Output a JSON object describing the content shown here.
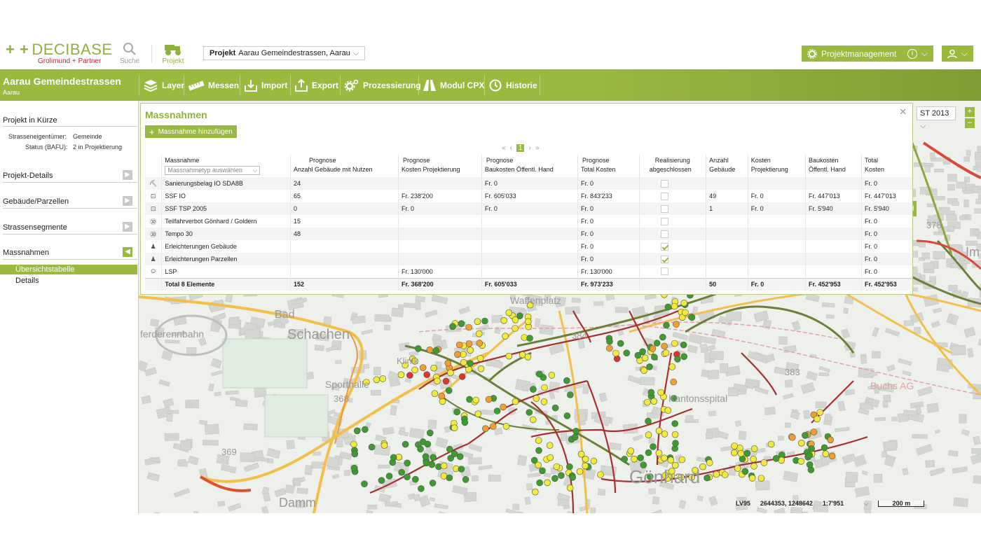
{
  "brand": {
    "name": "DECIBASE",
    "company": "Grolimund + Partner"
  },
  "topbar": {
    "search_label": "Suche",
    "project_label": "Projekt",
    "project_select_label": "Projekt",
    "project_select_value": "Aarau Gemeindestrassen, Aarau",
    "projektmanagement_label": "Projektmanagement"
  },
  "header": {
    "title": "Aarau Gemeindestrassen",
    "subtitle": "Aarau",
    "tools": [
      {
        "label": "Layer",
        "icon": "layers-icon"
      },
      {
        "label": "Messen",
        "icon": "ruler-icon"
      },
      {
        "label": "Import",
        "icon": "import-icon"
      },
      {
        "label": "Export",
        "icon": "export-icon"
      },
      {
        "label": "Prozessierung",
        "icon": "gear-icon"
      },
      {
        "label": "Modul CPX",
        "icon": "road-icon"
      },
      {
        "label": "Historie",
        "icon": "history-icon"
      }
    ]
  },
  "sidebar": {
    "summary_title": "Projekt in Kürze",
    "owner_label": "Strasseneigentümer:",
    "owner_value": "Gemeinde",
    "status_label": "Status (BAFU):",
    "status_value": "2 in Projektierung",
    "sections": [
      "Projekt-Details",
      "Gebäude/Parzellen",
      "Strassensegmente",
      "Massnahmen"
    ],
    "subitems": [
      "Übersichtstabelle",
      "Details"
    ]
  },
  "panel": {
    "title": "Massnahmen",
    "add_label": "Massnahme hinzufügen",
    "pager": {
      "first": "«",
      "prev": "‹",
      "current": "1",
      "next": "›",
      "last": "»"
    },
    "type_placeholder": "Massnahmetyp auswählen",
    "columns": [
      {
        "line1": "Massnahme",
        "line2": ""
      },
      {
        "line1": "Prognose",
        "line2": "Anzahl Gebäude mit Nutzen"
      },
      {
        "line1": "Prognose",
        "line2": "Kosten Projektierung"
      },
      {
        "line1": "Prognose",
        "line2": "Baukosten Öffentl. Hand"
      },
      {
        "line1": "Prognose",
        "line2": "Total Kosten"
      },
      {
        "line1": "Realisierung",
        "line2": "abgeschlossen"
      },
      {
        "line1": "Anzahl",
        "line2": "Gebäude"
      },
      {
        "line1": "Kosten",
        "line2": "Projektierung"
      },
      {
        "line1": "Baukosten",
        "line2": "Öffentl. Hand"
      },
      {
        "line1": "Total",
        "line2": "Kosten"
      }
    ],
    "rows": [
      {
        "icon": "paver-icon",
        "name": "Sanierungsbelag IO SDA8B",
        "anzahl": "24",
        "kproj": "",
        "bau": "Fr. 0",
        "total": "Fr. 0",
        "done": false,
        "geb": "",
        "kproj2": "",
        "bau2": "",
        "total2": "Fr. 0"
      },
      {
        "icon": "window-icon",
        "name": "SSF IO",
        "anzahl": "65",
        "kproj": "Fr. 238'200",
        "bau": "Fr. 605'033",
        "total": "Fr. 843'233",
        "done": false,
        "geb": "49",
        "kproj2": "Fr. 0",
        "bau2": "Fr. 447'013",
        "total2": "Fr. 447'013"
      },
      {
        "icon": "window-icon",
        "name": "SSF TSP 2005",
        "anzahl": "0",
        "kproj": "Fr. 0",
        "bau": "Fr. 0",
        "total": "Fr. 0",
        "done": false,
        "geb": "1",
        "kproj2": "Fr. 0",
        "bau2": "Fr. 5'940",
        "total2": "Fr. 5'940"
      },
      {
        "icon": "speed-30-icon",
        "name": "Teilfahrverbot Gönhard / Goldern",
        "anzahl": "15",
        "kproj": "",
        "bau": "",
        "total": "Fr. 0",
        "done": false,
        "geb": "",
        "kproj2": "",
        "bau2": "",
        "total2": "Fr. 0"
      },
      {
        "icon": "speed-30-icon",
        "name": "Tempo 30",
        "anzahl": "48",
        "kproj": "",
        "bau": "",
        "total": "Fr. 0",
        "done": false,
        "geb": "",
        "kproj2": "",
        "bau2": "",
        "total2": "Fr. 0"
      },
      {
        "icon": "person-icon",
        "name": "Erleichterungen Gebäude",
        "anzahl": "",
        "kproj": "",
        "bau": "",
        "total": "Fr. 0",
        "done": true,
        "geb": "",
        "kproj2": "",
        "bau2": "",
        "total2": "Fr. 0"
      },
      {
        "icon": "person-icon",
        "name": "Erleichterungen Parzellen",
        "anzahl": "",
        "kproj": "",
        "bau": "",
        "total": "Fr. 0",
        "done": true,
        "geb": "",
        "kproj2": "",
        "bau2": "",
        "total2": "Fr. 0"
      },
      {
        "icon": "more-icon",
        "name": "LSP",
        "anzahl": "",
        "kproj": "Fr. 130'000",
        "bau": "",
        "total": "Fr. 130'000",
        "done": false,
        "geb": "",
        "kproj2": "",
        "bau2": "",
        "total2": "Fr. 0"
      }
    ],
    "total": {
      "name": "Total 8 Elemente",
      "anzahl": "152",
      "kproj": "Fr. 368'200",
      "bau": "Fr. 605'033",
      "total": "Fr. 973'233",
      "geb": "50",
      "kproj2": "Fr. 0",
      "bau2": "Fr. 452'953",
      "total2": "Fr. 452'953"
    }
  },
  "map": {
    "layer_select": "ST 2013",
    "labels": [
      "Bad",
      "Schachen",
      "ferderennbahn",
      "Sporthalle",
      "368",
      "369",
      "Klinik",
      "Waffenplatz",
      "384",
      "383",
      "378",
      "Gönhard",
      "Kantonsspital",
      "Buchs AG",
      "Damm",
      "Im"
    ],
    "status": {
      "crs": "LV95",
      "coords": "2644353, 1248642",
      "scale": "1:7'951",
      "scalebar": "200 m"
    },
    "colors": {
      "green": "#3e9b2f",
      "yellow": "#f3eb3a",
      "orange": "#f0a030",
      "red": "#e0332c",
      "road": "#a6302e"
    }
  }
}
